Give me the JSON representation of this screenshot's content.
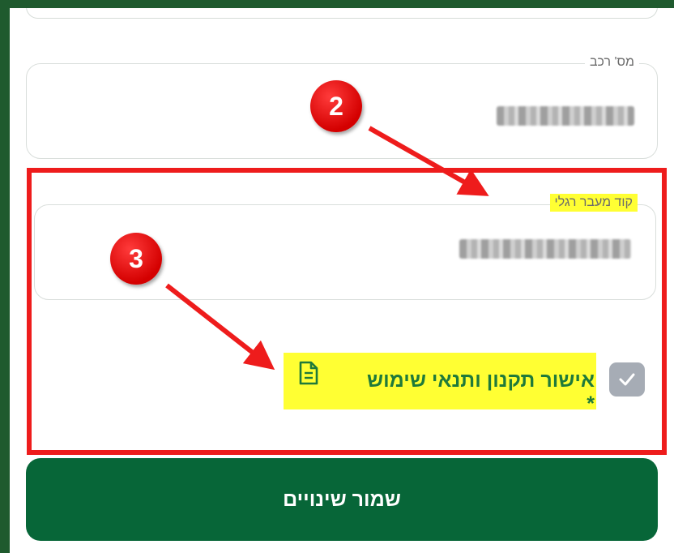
{
  "form": {
    "vehicle_number": {
      "label": "מס' רכב",
      "value": ""
    },
    "pedestrian_code": {
      "label": "קוד מעבר רגלי",
      "value": ""
    },
    "terms": {
      "label": "אישור תקנון ותנאי שימוש *",
      "checked": true
    },
    "save_label": "שמור שינויים"
  },
  "annotations": {
    "step_2": "2",
    "step_3": "3",
    "highlight_color": "#ffff33",
    "box_color": "#ee1c1c"
  },
  "colors": {
    "primary": "#076638",
    "text_green": "#1f7a3a",
    "frame": "#1f5a2e"
  }
}
